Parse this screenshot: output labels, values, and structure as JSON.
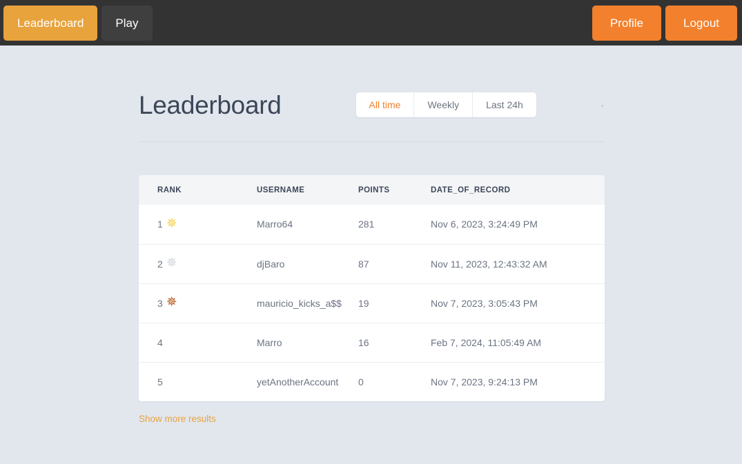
{
  "navbar": {
    "left_items": [
      {
        "label": "Leaderboard",
        "state": "active"
      },
      {
        "label": "Play",
        "state": "plain"
      }
    ],
    "right_items": [
      {
        "label": "Profile"
      },
      {
        "label": "Logout"
      }
    ],
    "background_color": "#333333",
    "active_color": "#e8a33d",
    "accent_color": "#f2802c"
  },
  "page": {
    "title": "Leaderboard",
    "background_color": "#e2e7ee"
  },
  "filters": {
    "options": [
      {
        "label": "All time",
        "active": true
      },
      {
        "label": "Weekly",
        "active": false
      },
      {
        "label": "Last 24h",
        "active": false
      }
    ],
    "active_text_color": "#f2802c"
  },
  "table": {
    "columns": [
      "RANK",
      "USERNAME",
      "POINTS",
      "DATE_OF_RECORD"
    ],
    "rows": [
      {
        "rank": "1",
        "medal": "gold-star-icon",
        "username": "Marro64",
        "points": "281",
        "date_of_record": "Nov 6, 2023, 3:24:49 PM"
      },
      {
        "rank": "2",
        "medal": "silver-star-icon",
        "username": "djBaro",
        "points": "87",
        "date_of_record": "Nov 11, 2023, 12:43:32 AM"
      },
      {
        "rank": "3",
        "medal": "bronze-star-icon",
        "username": "mauricio_kicks_a$$",
        "points": "19",
        "date_of_record": "Nov 7, 2023, 3:05:43 PM"
      },
      {
        "rank": "4",
        "medal": "",
        "username": "Marro",
        "points": "16",
        "date_of_record": "Feb 7, 2024, 11:05:49 AM"
      },
      {
        "rank": "5",
        "medal": "",
        "username": "yetAnotherAccount",
        "points": "0",
        "date_of_record": "Nov 7, 2023, 9:24:13 PM"
      }
    ],
    "header_background": "#f4f5f7",
    "medal_colors": {
      "gold": "#f7cf4a",
      "silver": "#d2d6dc",
      "bronze": "#b5551a"
    }
  },
  "footer": {
    "show_more_label": "Show more results",
    "show_more_color": "#e8a33d"
  }
}
